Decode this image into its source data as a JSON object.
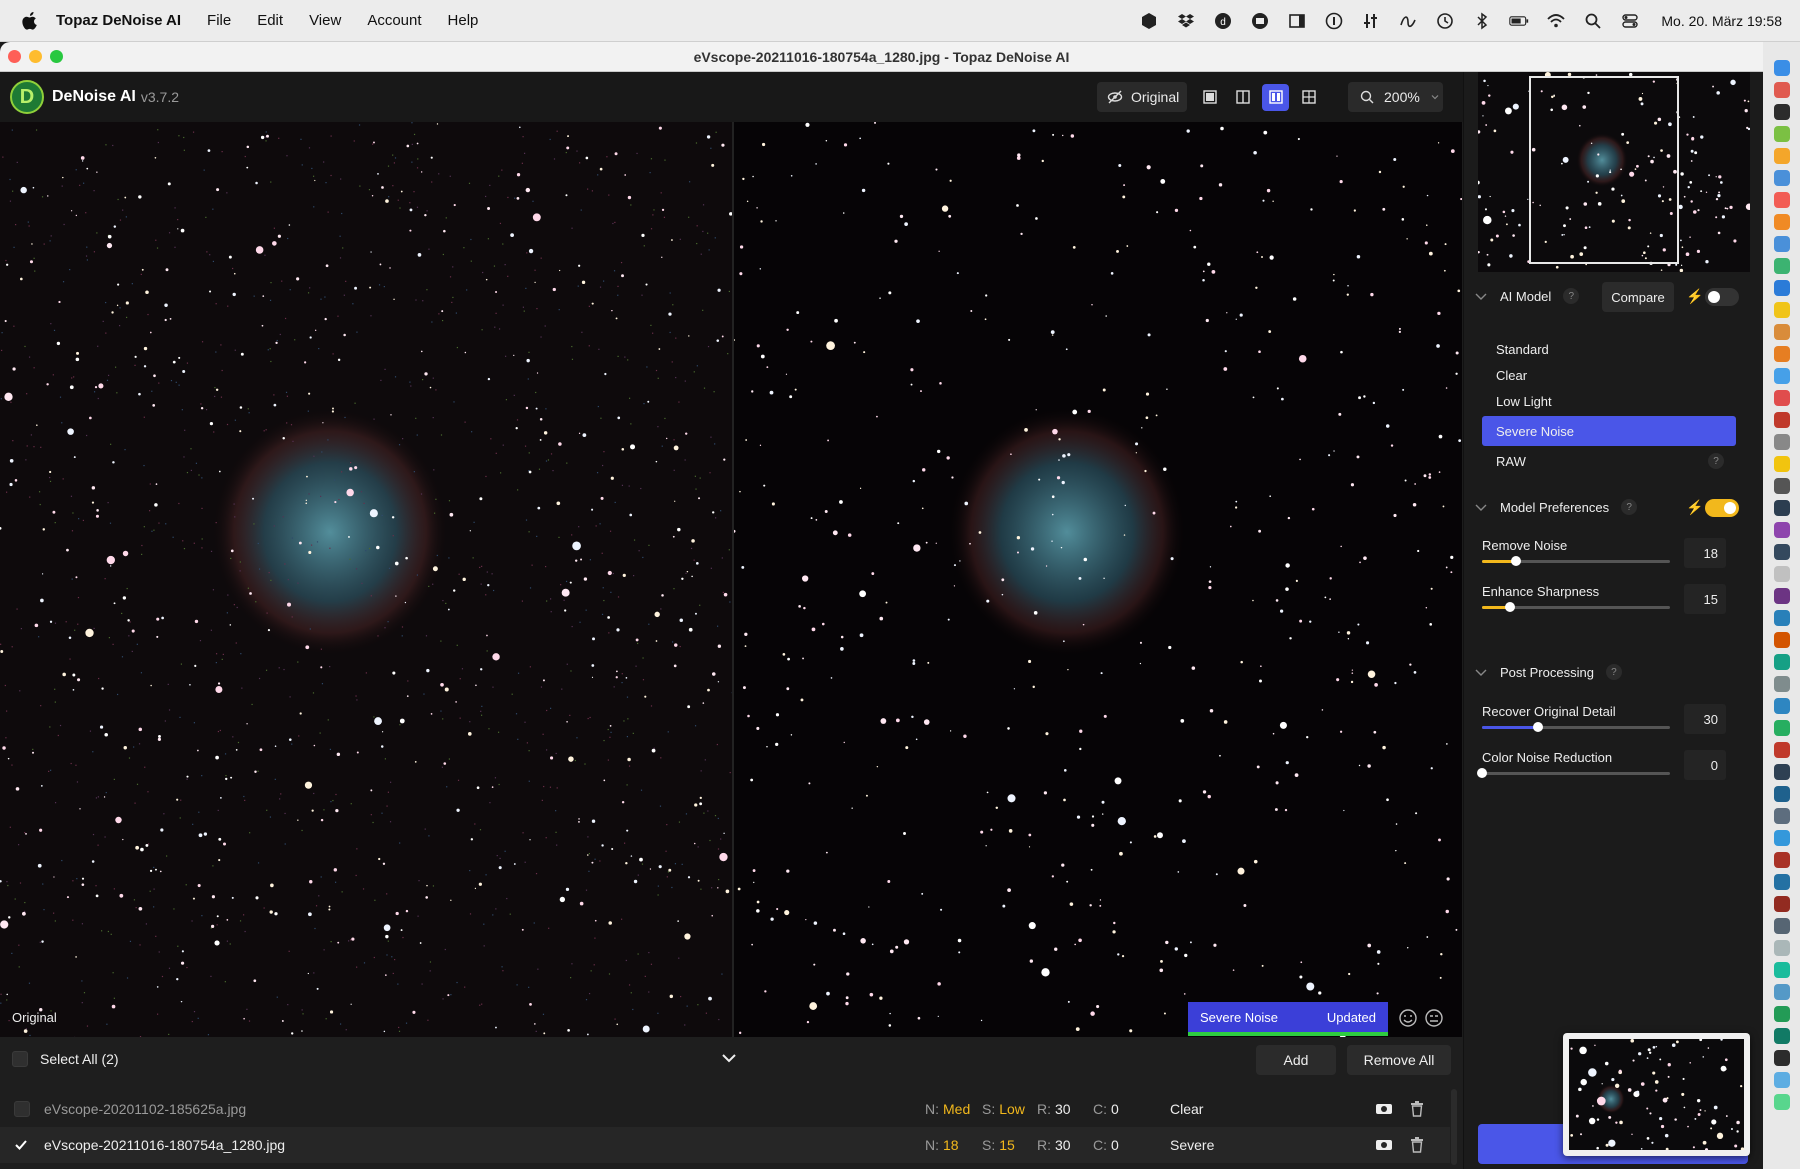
{
  "menubar": {
    "app_name": "Topaz DeNoise AI",
    "items": [
      "File",
      "Edit",
      "View",
      "Account",
      "Help"
    ],
    "clock": "Mo. 20. März  19:58"
  },
  "window": {
    "title": "eVscope-20211016-180754a_1280.jpg - Topaz DeNoise AI"
  },
  "app": {
    "name": "DeNoise AI",
    "version": "v3.7.2",
    "logo_letter": "D"
  },
  "toolbar": {
    "original_label": "Original",
    "zoom_label": "200%"
  },
  "preview": {
    "original_label": "Original",
    "model_status": "Severe Noise",
    "updated_status": "Updated"
  },
  "filelist": {
    "select_all_label": "Select All (2)",
    "add_label": "Add",
    "remove_all_label": "Remove All",
    "files": [
      {
        "name": "eVscope-20201102-185625a.jpg",
        "n_key": "N:",
        "n_val": "Med",
        "s_key": "S:",
        "s_val": "Low",
        "r_key": "R:",
        "r_val": "30",
        "c_key": "C:",
        "c_val": "0",
        "mode": "Clear",
        "checked": false
      },
      {
        "name": "eVscope-20211016-180754a_1280.jpg",
        "n_key": "N:",
        "n_val": "18",
        "s_key": "S:",
        "s_val": "15",
        "r_key": "R:",
        "r_val": "30",
        "c_key": "C:",
        "c_val": "0",
        "mode": "Severe",
        "checked": true
      }
    ]
  },
  "sidebar": {
    "ai_model_label": "AI Model",
    "compare_label": "Compare",
    "question_mark": "?",
    "models": [
      "Standard",
      "Clear",
      "Low Light",
      "Severe Noise",
      "RAW"
    ],
    "selected_model": "Severe Noise",
    "model_prefs_label": "Model Preferences",
    "model_prefs_enabled": true,
    "remove_noise_label": "Remove Noise",
    "remove_noise_value": "18",
    "remove_noise_level": 0.18,
    "enhance_sharpness_label": "Enhance Sharpness",
    "enhance_sharpness_value": "15",
    "enhance_sharpness_level": 0.15,
    "post_processing_label": "Post Processing",
    "recover_detail_label": "Recover Original Detail",
    "recover_detail_value": "30",
    "recover_detail_level": 0.3,
    "color_noise_label": "Color Noise Reduction",
    "color_noise_value": "0",
    "color_noise_level": 0.0
  },
  "colors": {
    "accent": "#4a56e8",
    "warning": "#f2b81c",
    "success": "#2ecc40"
  }
}
